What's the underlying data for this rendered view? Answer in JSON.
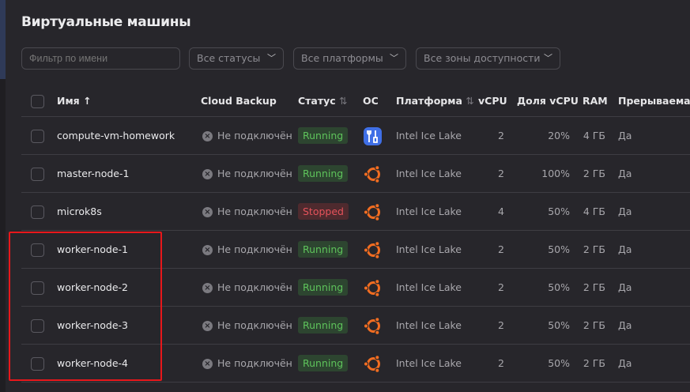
{
  "title": "Виртуальные машины",
  "filters": {
    "name_placeholder": "Фильтр по имени",
    "status": "Все статусы",
    "platform": "Все платформы",
    "zone": "Все зоны доступности"
  },
  "columns": {
    "name": "Имя",
    "name_sort": "↑",
    "backup": "Cloud Backup",
    "status": "Статус",
    "status_sort": "⇅",
    "os": "ОС",
    "platform": "Платформа",
    "platform_sort": "⇅",
    "vcpu": "vCPU",
    "share": "Доля vCPU",
    "ram": "RAM",
    "preemptible": "Прерываемая"
  },
  "rows": [
    {
      "name": "compute-vm-homework",
      "backup": "Не подключён",
      "status": "Running",
      "os": "custom",
      "platform": "Intel Ice Lake",
      "vcpu": "2",
      "share": "20%",
      "ram": "4 ГБ",
      "preemptible": "Да"
    },
    {
      "name": "master-node-1",
      "backup": "Не подключён",
      "status": "Running",
      "os": "ubuntu",
      "platform": "Intel Ice Lake",
      "vcpu": "2",
      "share": "100%",
      "ram": "2 ГБ",
      "preemptible": "Да"
    },
    {
      "name": "microk8s",
      "backup": "Не подключён",
      "status": "Stopped",
      "os": "ubuntu",
      "platform": "Intel Ice Lake",
      "vcpu": "4",
      "share": "50%",
      "ram": "4 ГБ",
      "preemptible": "Да"
    },
    {
      "name": "worker-node-1",
      "backup": "Не подключён",
      "status": "Running",
      "os": "ubuntu",
      "platform": "Intel Ice Lake",
      "vcpu": "2",
      "share": "50%",
      "ram": "2 ГБ",
      "preemptible": "Да"
    },
    {
      "name": "worker-node-2",
      "backup": "Не подключён",
      "status": "Running",
      "os": "ubuntu",
      "platform": "Intel Ice Lake",
      "vcpu": "2",
      "share": "50%",
      "ram": "2 ГБ",
      "preemptible": "Да"
    },
    {
      "name": "worker-node-3",
      "backup": "Не подключён",
      "status": "Running",
      "os": "ubuntu",
      "platform": "Intel Ice Lake",
      "vcpu": "2",
      "share": "50%",
      "ram": "2 ГБ",
      "preemptible": "Да"
    },
    {
      "name": "worker-node-4",
      "backup": "Не подключён",
      "status": "Running",
      "os": "ubuntu",
      "platform": "Intel Ice Lake",
      "vcpu": "2",
      "share": "50%",
      "ram": "2 ГБ",
      "preemptible": "Да"
    }
  ],
  "colors": {
    "running": "#5ec35b",
    "stopped": "#e5535b",
    "highlight": "#e8171b"
  }
}
